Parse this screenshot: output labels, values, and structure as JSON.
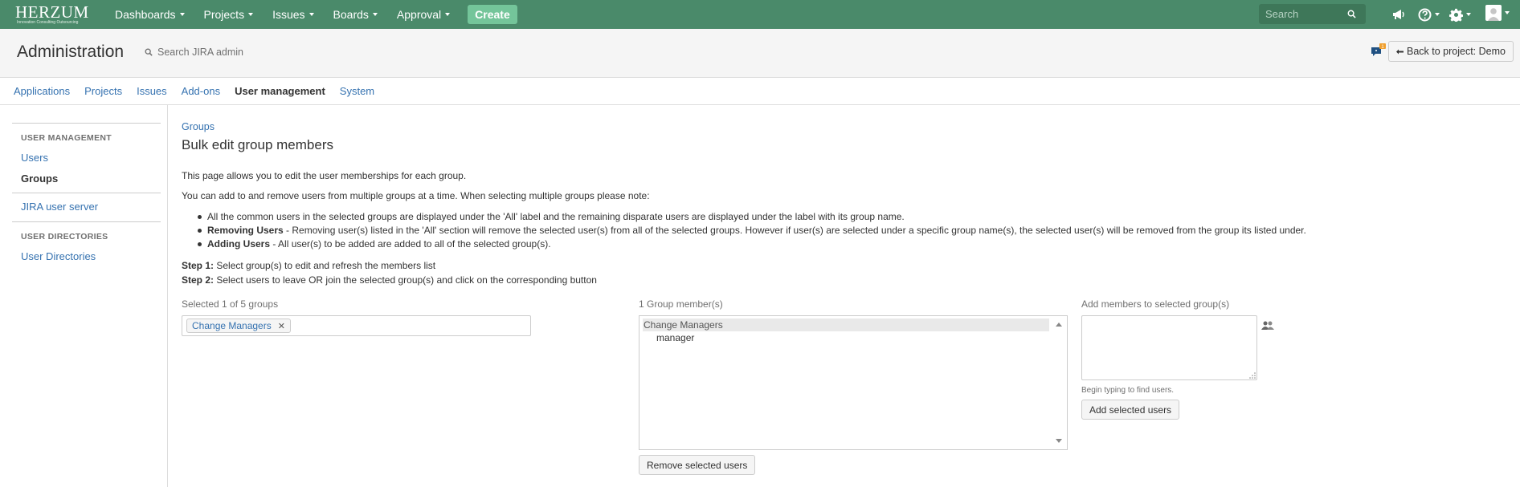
{
  "topnav": {
    "logo_text": "HERZUM",
    "logo_tagline": "Innovation Consulting Outsourcing",
    "menu": [
      {
        "label": "Dashboards"
      },
      {
        "label": "Projects"
      },
      {
        "label": "Issues"
      },
      {
        "label": "Boards"
      },
      {
        "label": "Approval"
      }
    ],
    "create_label": "Create",
    "search_placeholder": "Search",
    "icons": [
      "search-icon",
      "megaphone-icon",
      "help-icon",
      "gear-icon",
      "avatar-icon"
    ]
  },
  "admin": {
    "title": "Administration",
    "search_placeholder": "Search JIRA admin",
    "notification_count": "1",
    "back_label": "Back to project: Demo"
  },
  "tabs": [
    {
      "label": "Applications",
      "active": false
    },
    {
      "label": "Projects",
      "active": false
    },
    {
      "label": "Issues",
      "active": false
    },
    {
      "label": "Add-ons",
      "active": false
    },
    {
      "label": "User management",
      "active": true
    },
    {
      "label": "System",
      "active": false
    }
  ],
  "sidebar": {
    "section1_heading": "USER MANAGEMENT",
    "users": "Users",
    "groups": "Groups",
    "jira_user_server": "JIRA user server",
    "section2_heading": "USER DIRECTORIES",
    "user_directories": "User Directories"
  },
  "main": {
    "breadcrumb": "Groups",
    "title": "Bulk edit group members",
    "intro": "This page allows you to edit the user memberships for each group.",
    "intro2": "You can add to and remove users from multiple groups at a time. When selecting multiple groups please note:",
    "bullet1": "All the common users in the selected groups are displayed under the 'All' label and the remaining disparate users are displayed under the label with its group name.",
    "bullet2_bold": "Removing Users",
    "bullet2": " - Removing user(s) listed in the 'All' section will remove the selected user(s) from all of the selected groups. However if user(s) are selected under a specific group name(s), the selected user(s) will be removed from the group its listed under.",
    "bullet3_bold": "Adding Users",
    "bullet3": " - All user(s) to be added are added to all of the selected group(s).",
    "step1_bold": "Step 1:",
    "step1": " Select group(s) to edit and refresh the members list",
    "step2_bold": "Step 2:",
    "step2": " Select users to leave OR join the selected group(s) and click on the corresponding button",
    "selected_label": "Selected 1 of 5 groups",
    "selected_group": "Change Managers",
    "members_label": "1 Group member(s)",
    "member_group": "Change Managers",
    "member": "manager",
    "remove_button": "Remove selected users",
    "add_label": "Add members to selected group(s)",
    "add_hint": "Begin typing to find users.",
    "add_button": "Add selected users"
  }
}
